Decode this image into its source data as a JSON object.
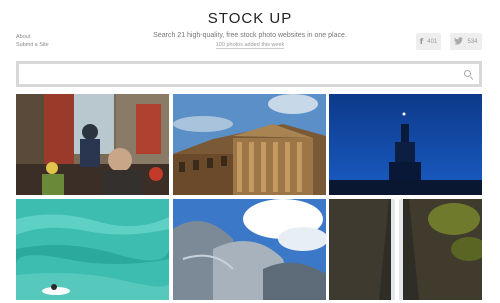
{
  "nav": {
    "about": "About",
    "submit": "Submit a Site"
  },
  "header": {
    "logo": "STOCK UP",
    "tagline": "Search 21 high-quality, free stock photo websites in one place.",
    "added": "100 photos added this week"
  },
  "share": {
    "facebook_count": "401",
    "twitter_count": "534",
    "facebook_icon": "facebook-icon",
    "twitter_icon": "twitter-icon"
  },
  "search": {
    "value": "",
    "placeholder": ""
  },
  "photos": [
    {
      "subject": "child-on-shoulders-street"
    },
    {
      "subject": "classical-building-columns"
    },
    {
      "subject": "statue-night-blue-sky"
    },
    {
      "subject": "turquoise-water-swimmer"
    },
    {
      "subject": "curved-metal-architecture"
    },
    {
      "subject": "waterfall-mossy-cliff"
    }
  ],
  "colors": {
    "search_border": "#d8d8d8",
    "share_bg": "#eeeeee",
    "text_muted": "#888888"
  }
}
